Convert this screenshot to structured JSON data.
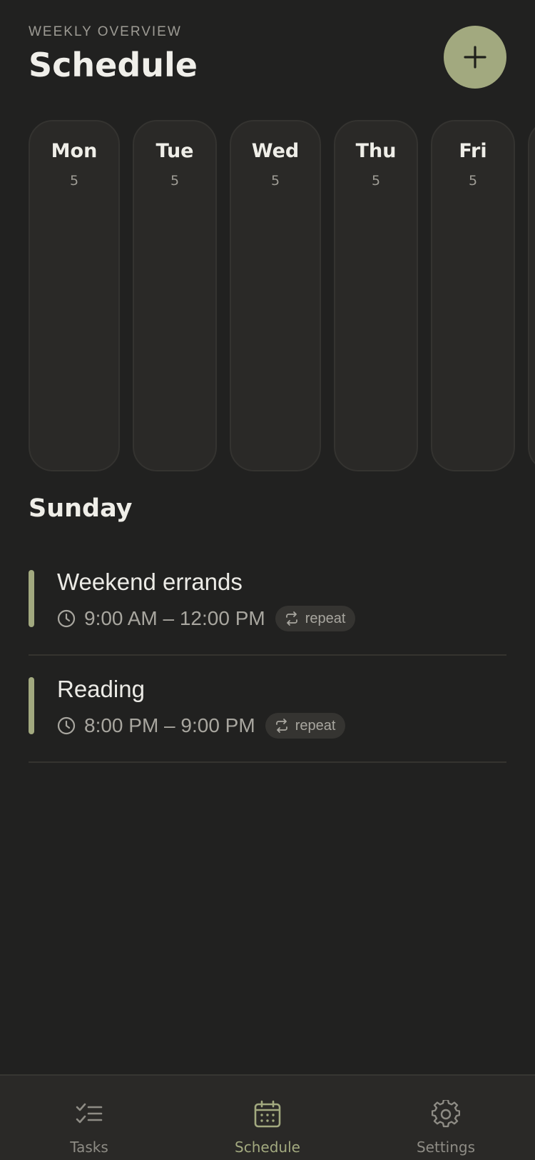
{
  "header": {
    "eyebrow": "WEEKLY OVERVIEW",
    "title": "Schedule",
    "add_button_icon": "plus-icon"
  },
  "days": [
    {
      "name": "Mon",
      "count": "5"
    },
    {
      "name": "Tue",
      "count": "5"
    },
    {
      "name": "Wed",
      "count": "5"
    },
    {
      "name": "Thu",
      "count": "5"
    },
    {
      "name": "Fri",
      "count": "5"
    },
    {
      "name": "",
      "count": ""
    }
  ],
  "selected_day": {
    "title": "Sunday",
    "events": [
      {
        "title": "Weekend errands",
        "time": "9:00 AM – 12:00 PM",
        "tag": "repeat"
      },
      {
        "title": "Reading",
        "time": "8:00 PM – 9:00 PM",
        "tag": "repeat"
      }
    ]
  },
  "tabbar": {
    "tabs": [
      {
        "label": "Tasks",
        "icon": "checklist-icon",
        "active": false
      },
      {
        "label": "Schedule",
        "icon": "calendar-icon",
        "active": true
      },
      {
        "label": "Settings",
        "icon": "gear-icon",
        "active": false
      }
    ]
  },
  "colors": {
    "background": "#212120",
    "accent": "#a2a97f",
    "card": "#2a2927",
    "text_primary": "#ecebe6",
    "text_secondary": "#a8a69f"
  }
}
